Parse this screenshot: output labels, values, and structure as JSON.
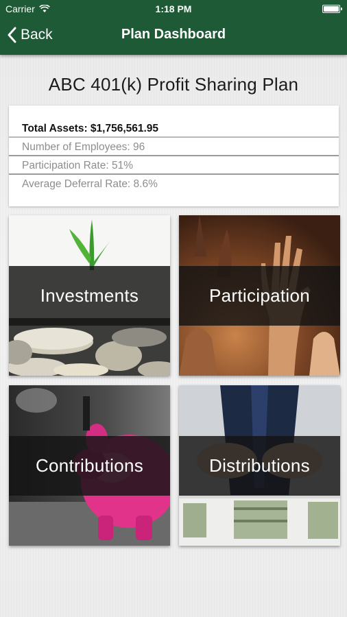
{
  "status_bar": {
    "carrier": "Carrier",
    "time": "1:18 PM"
  },
  "nav": {
    "back_label": "Back",
    "title": "Plan Dashboard"
  },
  "plan": {
    "name": "ABC 401(k) Profit Sharing Plan"
  },
  "stats": {
    "total_assets": "Total Assets: $1,756,561.95",
    "employees": "Number of Employees: 96",
    "participation": "Participation Rate: 51%",
    "deferral": "Average Deferral Rate: 8.6%"
  },
  "tiles": {
    "investments": "Investments",
    "participation": "Participation",
    "contributions": "Contributions",
    "distributions": "Distributions"
  },
  "colors": {
    "nav_bar": "#1e5a35",
    "piggy": "#e2338a"
  }
}
